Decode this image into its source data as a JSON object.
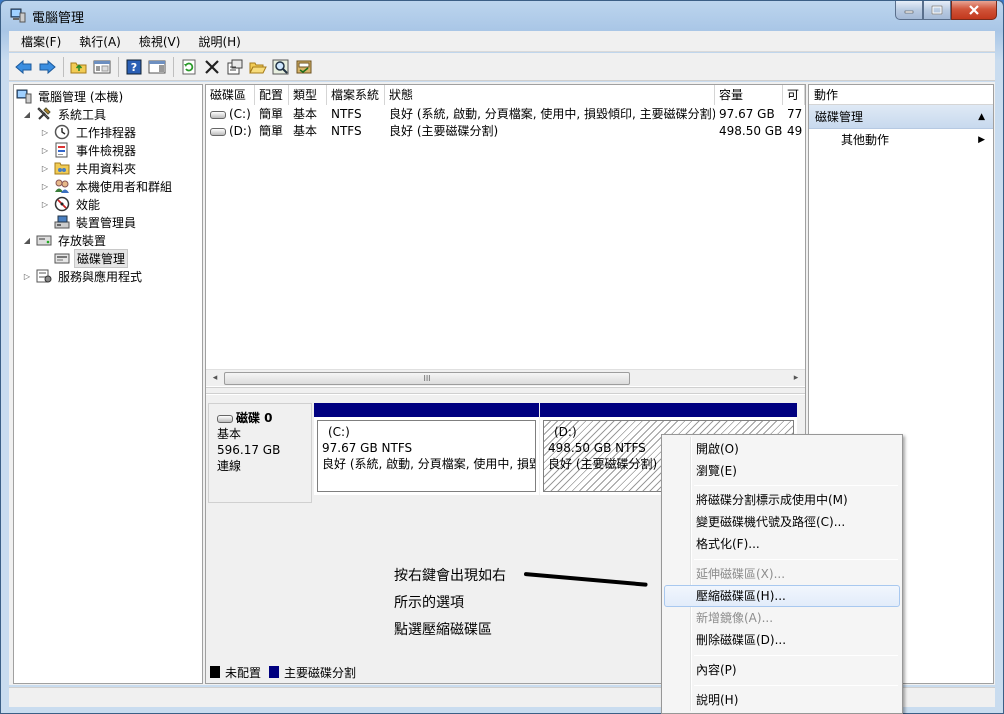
{
  "window": {
    "title": "電腦管理"
  },
  "menubar": [
    {
      "label": "檔案(F)"
    },
    {
      "label": "執行(A)"
    },
    {
      "label": "檢視(V)"
    },
    {
      "label": "說明(H)"
    }
  ],
  "tree": {
    "root": "電腦管理 (本機)",
    "system_tools": "系統工具",
    "task_scheduler": "工作排程器",
    "event_viewer": "事件檢視器",
    "shared_folders": "共用資料夾",
    "local_users": "本機使用者和群組",
    "performance": "效能",
    "device_manager": "裝置管理員",
    "storage": "存放裝置",
    "disk_management": "磁碟管理",
    "services_apps": "服務與應用程式"
  },
  "volume_list": {
    "columns": [
      "磁碟區",
      "配置",
      "類型",
      "檔案系統",
      "狀態",
      "容量",
      "可"
    ],
    "rows": [
      {
        "volume": "(C:)",
        "layout": "簡單",
        "type": "基本",
        "fs": "NTFS",
        "status": "良好 (系統, 啟動, 分頁檔案, 使用中, 損毀傾印, 主要磁碟分割)",
        "capacity": "97.67 GB",
        "free": "77"
      },
      {
        "volume": "(D:)",
        "layout": "簡單",
        "type": "基本",
        "fs": "NTFS",
        "status": "良好 (主要磁碟分割)",
        "capacity": "498.50 GB",
        "free": "49"
      }
    ],
    "scroll_thumb": "III"
  },
  "disk": {
    "name": "磁碟 0",
    "type": "基本",
    "size": "596.17 GB",
    "state": "連線",
    "partitions": [
      {
        "letter": "(C:)",
        "size_fs": "97.67 GB NTFS",
        "status": "良好 (系統, 啟動, 分頁檔案, 使用中, 損毀"
      },
      {
        "letter": "(D:)",
        "size_fs": "498.50 GB NTFS",
        "status": "良好 (主要磁碟分割)"
      }
    ]
  },
  "legend": {
    "unallocated": "未配置",
    "primary": "主要磁碟分割",
    "unallocated_color": "#000000",
    "primary_color": "#000080"
  },
  "actions": {
    "header": "動作",
    "section": "磁碟管理",
    "more": "其他動作"
  },
  "annotation": {
    "line1": "按右鍵會出現如右",
    "line2": "所示的選項",
    "line3": "點選壓縮磁碟區"
  },
  "context_menu": {
    "open": "開啟(O)",
    "explore": "瀏覽(E)",
    "mark_active": "將磁碟分割標示成使用中(M)",
    "change_letter": "變更磁碟機代號及路徑(C)...",
    "format": "格式化(F)...",
    "extend": "延伸磁碟區(X)...",
    "shrink": "壓縮磁碟區(H)...",
    "add_mirror": "新增鏡像(A)...",
    "delete": "刪除磁碟區(D)...",
    "properties": "內容(P)",
    "help": "說明(H)"
  },
  "colors": {
    "partition_bar": "#000080",
    "title_bar": "#bcd5ee",
    "close_button": "#c2381d"
  }
}
